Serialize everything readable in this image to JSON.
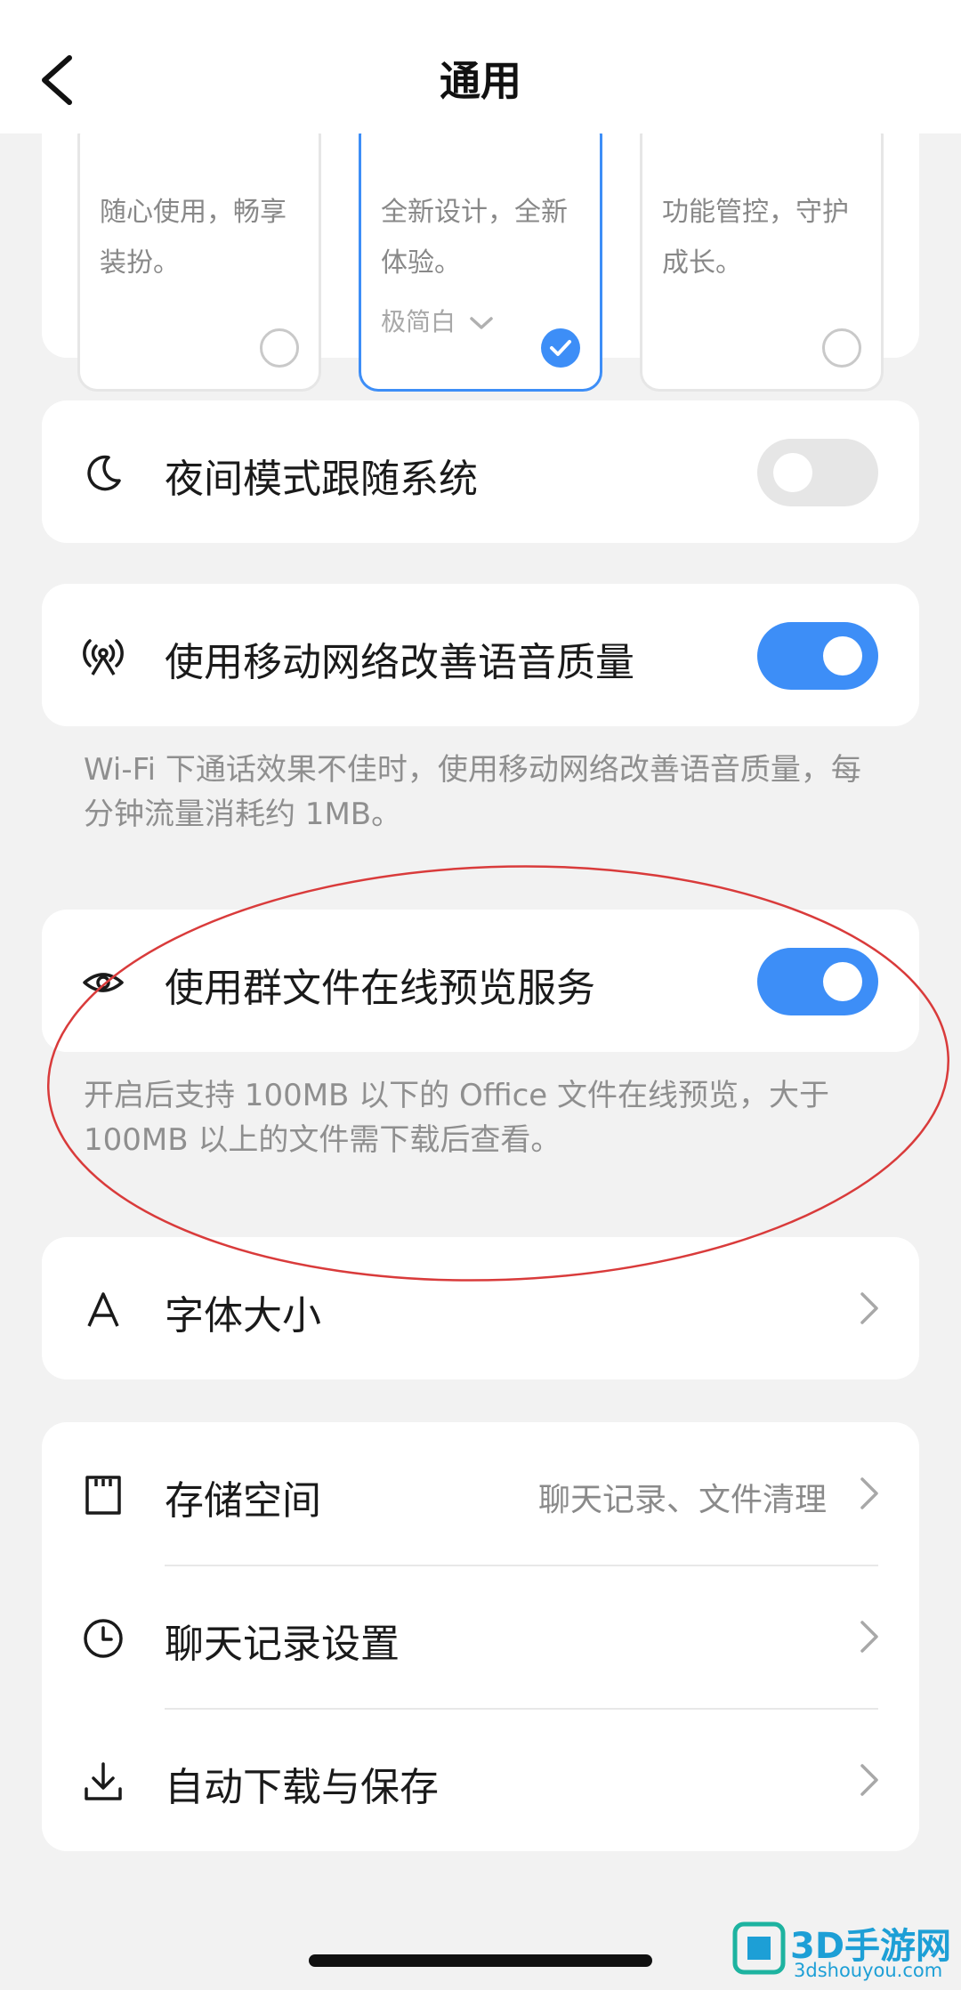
{
  "header": {
    "title": "通用",
    "back_icon": "chevron-left-icon"
  },
  "theme": {
    "options": [
      {
        "desc": "随心使用，畅享装扮。",
        "name": "",
        "selected": false
      },
      {
        "desc": "全新设计，全新体验。",
        "name": "极简白",
        "selected": true
      },
      {
        "desc": "功能管控，守护成长。",
        "name": "",
        "selected": false
      }
    ]
  },
  "night_mode": {
    "icon": "moon-icon",
    "label": "夜间模式跟随系统",
    "enabled": false
  },
  "mobile_voice": {
    "icon": "antenna-icon",
    "label": "使用移动网络改善语音质量",
    "enabled": true,
    "note": "Wi-Fi 下通话效果不佳时，使用移动网络改善语音质量，每分钟流量消耗约 1MB。"
  },
  "group_preview": {
    "icon": "eye-icon",
    "label": "使用群文件在线预览服务",
    "enabled": true,
    "note": "开启后支持 100MB 以下的 Office 文件在线预览，大于 100MB 以上的文件需下载后查看。"
  },
  "font_size": {
    "icon": "font-a-icon",
    "label": "字体大小"
  },
  "storage": {
    "icon": "storage-card-icon",
    "label": "存储空间",
    "value": "聊天记录、文件清理"
  },
  "chat_history": {
    "icon": "clock-icon",
    "label": "聊天记录设置"
  },
  "auto_download": {
    "icon": "download-icon",
    "label": "自动下载与保存"
  },
  "watermark": {
    "text": "3D手游网",
    "url": "3dshouyou.com"
  },
  "colors": {
    "accent": "#3d8ef7",
    "background": "#f2f2f2",
    "annotation": "#d93b3b"
  }
}
